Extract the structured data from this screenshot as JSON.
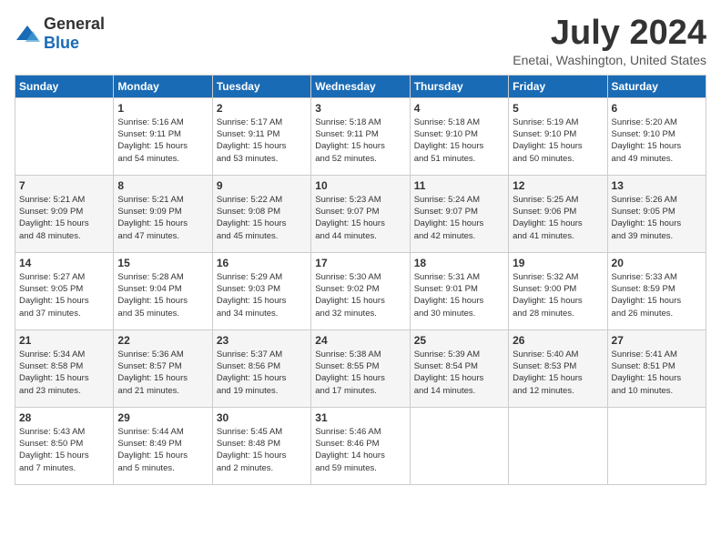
{
  "logo": {
    "general": "General",
    "blue": "Blue"
  },
  "title": "July 2024",
  "subtitle": "Enetai, Washington, United States",
  "headers": [
    "Sunday",
    "Monday",
    "Tuesday",
    "Wednesday",
    "Thursday",
    "Friday",
    "Saturday"
  ],
  "weeks": [
    [
      {
        "day": "",
        "info": ""
      },
      {
        "day": "1",
        "info": "Sunrise: 5:16 AM\nSunset: 9:11 PM\nDaylight: 15 hours\nand 54 minutes."
      },
      {
        "day": "2",
        "info": "Sunrise: 5:17 AM\nSunset: 9:11 PM\nDaylight: 15 hours\nand 53 minutes."
      },
      {
        "day": "3",
        "info": "Sunrise: 5:18 AM\nSunset: 9:11 PM\nDaylight: 15 hours\nand 52 minutes."
      },
      {
        "day": "4",
        "info": "Sunrise: 5:18 AM\nSunset: 9:10 PM\nDaylight: 15 hours\nand 51 minutes."
      },
      {
        "day": "5",
        "info": "Sunrise: 5:19 AM\nSunset: 9:10 PM\nDaylight: 15 hours\nand 50 minutes."
      },
      {
        "day": "6",
        "info": "Sunrise: 5:20 AM\nSunset: 9:10 PM\nDaylight: 15 hours\nand 49 minutes."
      }
    ],
    [
      {
        "day": "7",
        "info": "Sunrise: 5:21 AM\nSunset: 9:09 PM\nDaylight: 15 hours\nand 48 minutes."
      },
      {
        "day": "8",
        "info": "Sunrise: 5:21 AM\nSunset: 9:09 PM\nDaylight: 15 hours\nand 47 minutes."
      },
      {
        "day": "9",
        "info": "Sunrise: 5:22 AM\nSunset: 9:08 PM\nDaylight: 15 hours\nand 45 minutes."
      },
      {
        "day": "10",
        "info": "Sunrise: 5:23 AM\nSunset: 9:07 PM\nDaylight: 15 hours\nand 44 minutes."
      },
      {
        "day": "11",
        "info": "Sunrise: 5:24 AM\nSunset: 9:07 PM\nDaylight: 15 hours\nand 42 minutes."
      },
      {
        "day": "12",
        "info": "Sunrise: 5:25 AM\nSunset: 9:06 PM\nDaylight: 15 hours\nand 41 minutes."
      },
      {
        "day": "13",
        "info": "Sunrise: 5:26 AM\nSunset: 9:05 PM\nDaylight: 15 hours\nand 39 minutes."
      }
    ],
    [
      {
        "day": "14",
        "info": "Sunrise: 5:27 AM\nSunset: 9:05 PM\nDaylight: 15 hours\nand 37 minutes."
      },
      {
        "day": "15",
        "info": "Sunrise: 5:28 AM\nSunset: 9:04 PM\nDaylight: 15 hours\nand 35 minutes."
      },
      {
        "day": "16",
        "info": "Sunrise: 5:29 AM\nSunset: 9:03 PM\nDaylight: 15 hours\nand 34 minutes."
      },
      {
        "day": "17",
        "info": "Sunrise: 5:30 AM\nSunset: 9:02 PM\nDaylight: 15 hours\nand 32 minutes."
      },
      {
        "day": "18",
        "info": "Sunrise: 5:31 AM\nSunset: 9:01 PM\nDaylight: 15 hours\nand 30 minutes."
      },
      {
        "day": "19",
        "info": "Sunrise: 5:32 AM\nSunset: 9:00 PM\nDaylight: 15 hours\nand 28 minutes."
      },
      {
        "day": "20",
        "info": "Sunrise: 5:33 AM\nSunset: 8:59 PM\nDaylight: 15 hours\nand 26 minutes."
      }
    ],
    [
      {
        "day": "21",
        "info": "Sunrise: 5:34 AM\nSunset: 8:58 PM\nDaylight: 15 hours\nand 23 minutes."
      },
      {
        "day": "22",
        "info": "Sunrise: 5:36 AM\nSunset: 8:57 PM\nDaylight: 15 hours\nand 21 minutes."
      },
      {
        "day": "23",
        "info": "Sunrise: 5:37 AM\nSunset: 8:56 PM\nDaylight: 15 hours\nand 19 minutes."
      },
      {
        "day": "24",
        "info": "Sunrise: 5:38 AM\nSunset: 8:55 PM\nDaylight: 15 hours\nand 17 minutes."
      },
      {
        "day": "25",
        "info": "Sunrise: 5:39 AM\nSunset: 8:54 PM\nDaylight: 15 hours\nand 14 minutes."
      },
      {
        "day": "26",
        "info": "Sunrise: 5:40 AM\nSunset: 8:53 PM\nDaylight: 15 hours\nand 12 minutes."
      },
      {
        "day": "27",
        "info": "Sunrise: 5:41 AM\nSunset: 8:51 PM\nDaylight: 15 hours\nand 10 minutes."
      }
    ],
    [
      {
        "day": "28",
        "info": "Sunrise: 5:43 AM\nSunset: 8:50 PM\nDaylight: 15 hours\nand 7 minutes."
      },
      {
        "day": "29",
        "info": "Sunrise: 5:44 AM\nSunset: 8:49 PM\nDaylight: 15 hours\nand 5 minutes."
      },
      {
        "day": "30",
        "info": "Sunrise: 5:45 AM\nSunset: 8:48 PM\nDaylight: 15 hours\nand 2 minutes."
      },
      {
        "day": "31",
        "info": "Sunrise: 5:46 AM\nSunset: 8:46 PM\nDaylight: 14 hours\nand 59 minutes."
      },
      {
        "day": "",
        "info": ""
      },
      {
        "day": "",
        "info": ""
      },
      {
        "day": "",
        "info": ""
      }
    ]
  ]
}
